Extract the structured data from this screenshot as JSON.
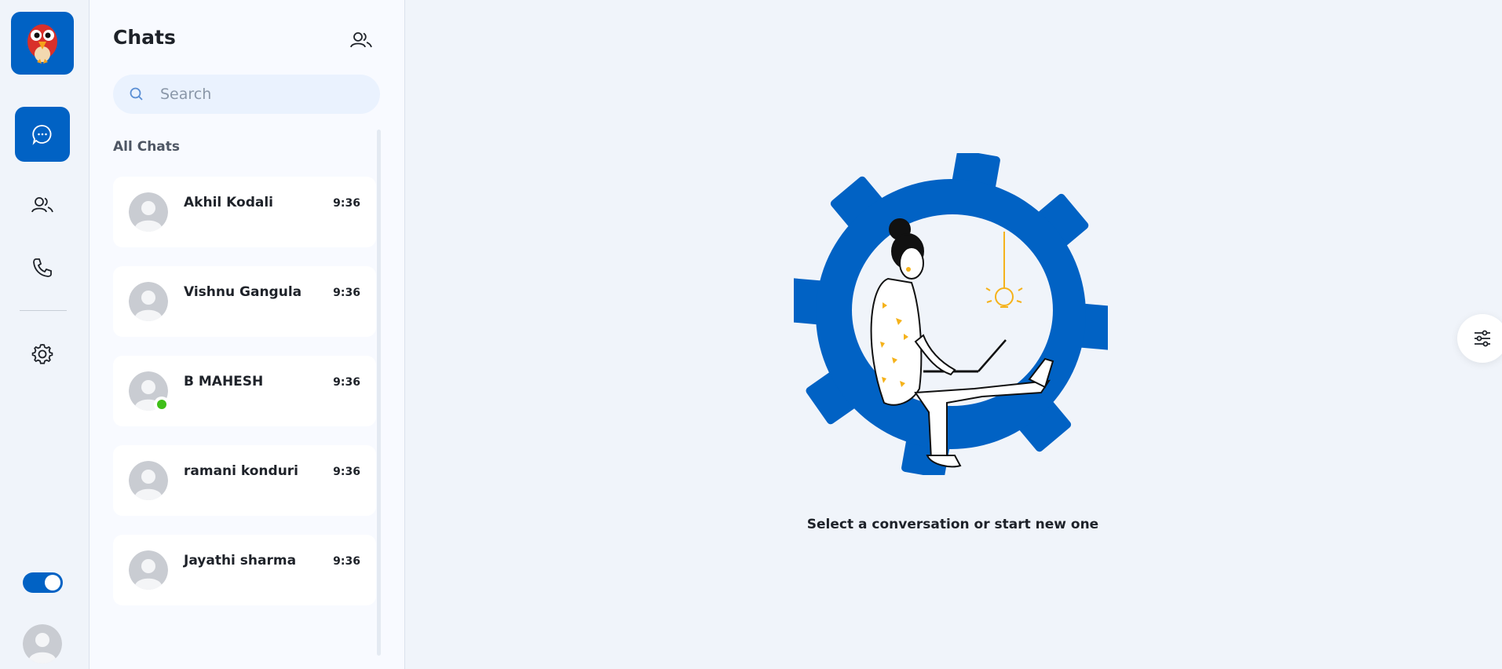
{
  "colors": {
    "accent": "#0162c4",
    "online": "#3fbf18",
    "background": "#f0f4fa",
    "panel": "#f8faff"
  },
  "rail": {
    "logo_icon": "parrot-logo-icon",
    "nav": [
      {
        "name": "chats",
        "icon": "chat-bubble-icon",
        "active": true
      },
      {
        "name": "contacts",
        "icon": "users-icon",
        "active": false
      },
      {
        "name": "calls",
        "icon": "phone-icon",
        "active": false
      },
      {
        "name": "settings",
        "icon": "gear-icon",
        "active": false
      }
    ],
    "theme_toggle_on": true
  },
  "panel": {
    "title": "Chats",
    "header_icon": "users-icon",
    "search_placeholder": "Search",
    "section_label": "All Chats",
    "chats": [
      {
        "name": "Akhil Kodali",
        "time": "9:36",
        "online": false
      },
      {
        "name": "Vishnu Gangula",
        "time": "9:36",
        "online": false
      },
      {
        "name": "B MAHESH",
        "time": "9:36",
        "online": true
      },
      {
        "name": "ramani konduri",
        "time": "9:36",
        "online": false
      },
      {
        "name": "Jayathi sharma",
        "time": "9:36",
        "online": false
      }
    ]
  },
  "main": {
    "empty_message": "Select a conversation or start new one",
    "illustration": "person-with-laptop-in-gear-illustration",
    "float_icon": "sliders-icon"
  }
}
